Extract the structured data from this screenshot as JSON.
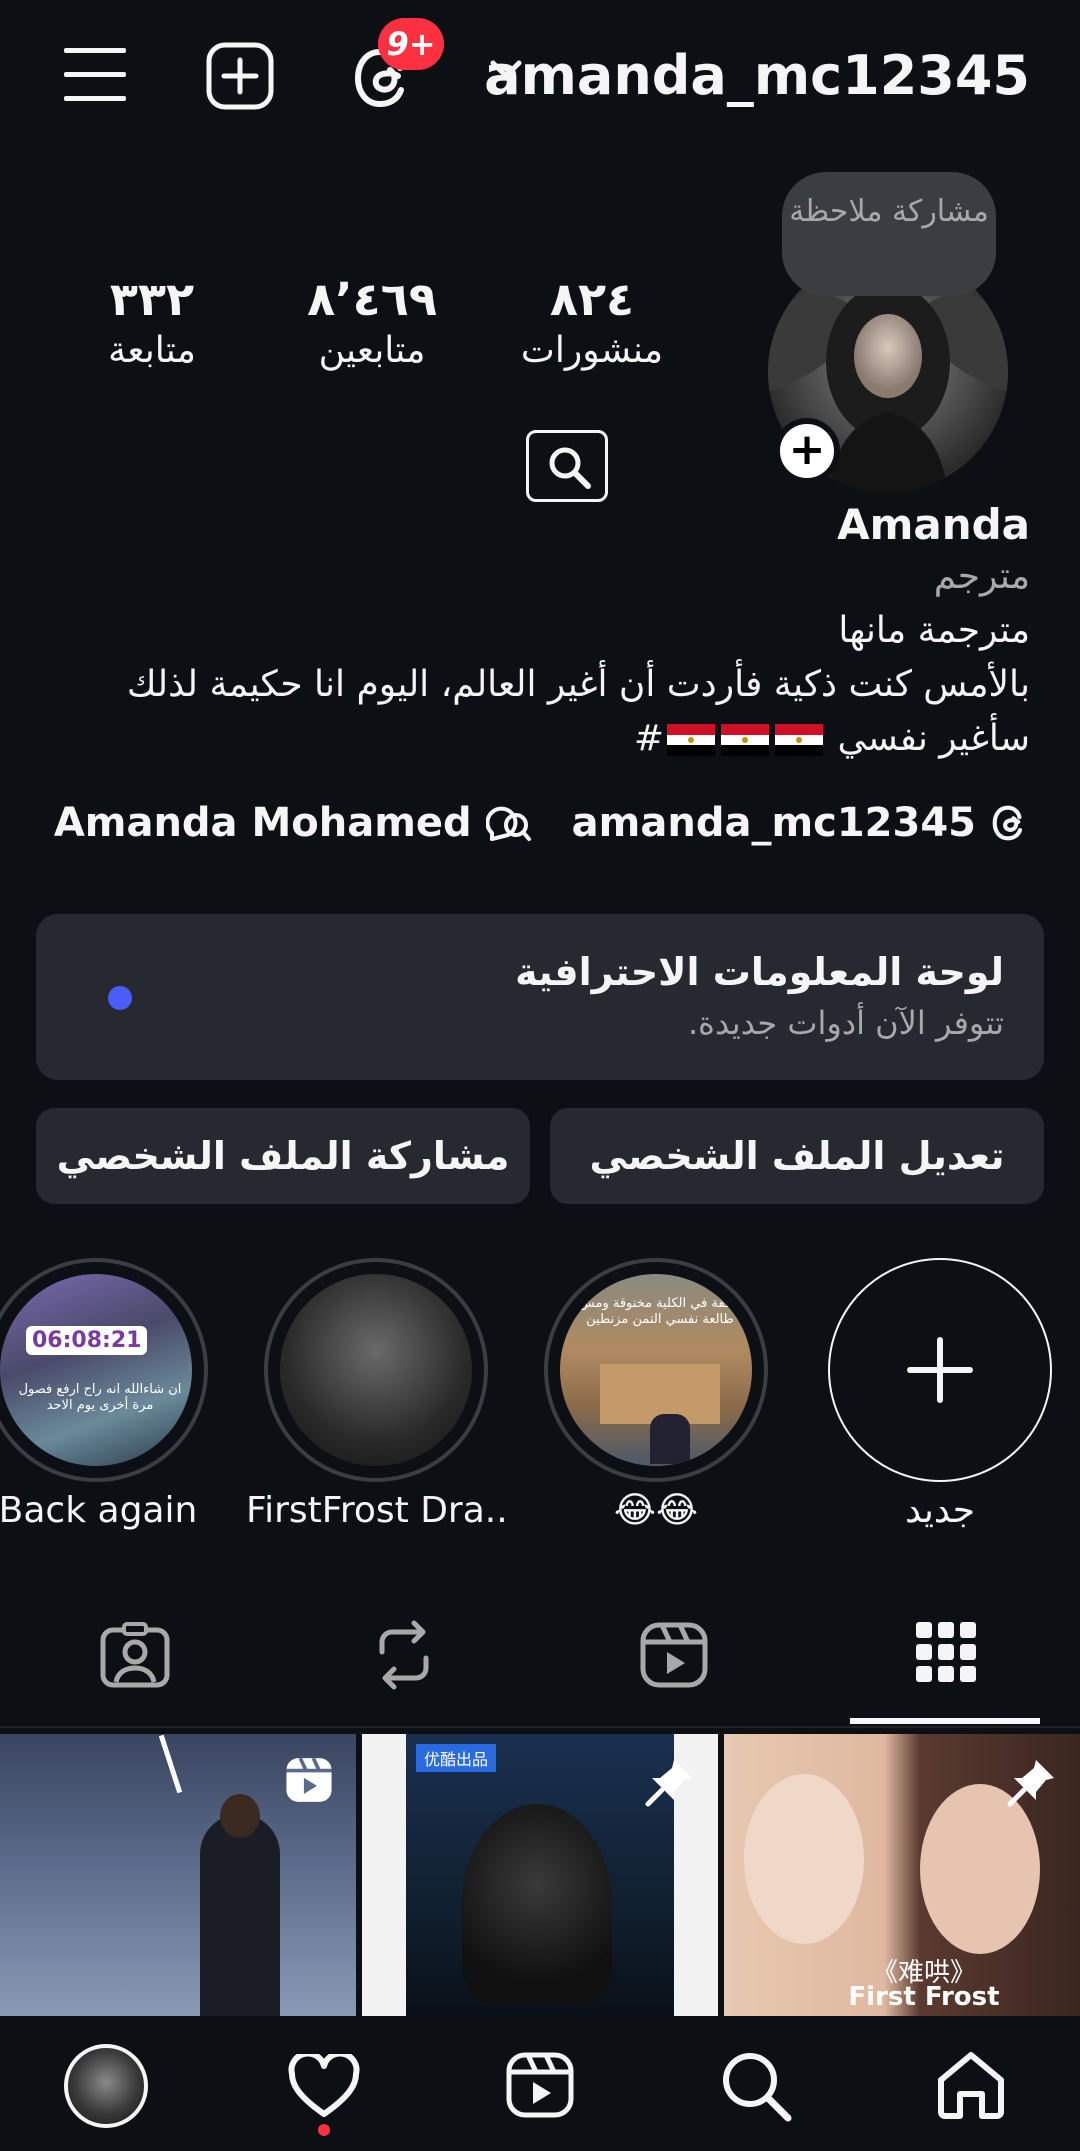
{
  "topbar": {
    "username": "amanda_mc12345",
    "threads_badge": "9+",
    "icons": [
      "menu-icon",
      "create-icon",
      "threads-icon",
      "chevron-down-icon"
    ]
  },
  "profile": {
    "note": "مشاركة ملاحظة",
    "add_story": "+",
    "stats": {
      "posts": {
        "value": "٨٢٤",
        "label": "منشورات"
      },
      "followers": {
        "value": "٨٬٤٦٩",
        "label": "متابعين"
      },
      "following": {
        "value": "٣٣٢",
        "label": "متابعة"
      }
    },
    "name": "Amanda",
    "category": "مترجم",
    "bio_line1": "مترجمة مانها",
    "bio_line2": "بالأمس كنت ذكية فأردت أن أغير العالم، اليوم انا حكيمة لذلك",
    "bio_line3_text": "سأغير نفسي",
    "bio_line3_hash": "#",
    "threads_link": "amanda_mc12345",
    "link_name": "Amanda Mohamed"
  },
  "pro_dashboard": {
    "title": "لوحة المعلومات الاحترافية",
    "subtitle": "تتوفر الآن أدوات جديدة."
  },
  "buttons": {
    "edit": "تعديل الملف الشخصي",
    "share": "مشاركة الملف الشخصي"
  },
  "highlights": [
    {
      "label": "جديد"
    },
    {
      "label": "😂😂"
    },
    {
      "label": "FirstFrost Dra..."
    },
    {
      "label": "Back again"
    }
  ],
  "highlight_overlays": {
    "timer": "06:08:21",
    "back_again_caption": "ان شاءالله انه راح ارفع فصول مرة أخرى يوم الاحد",
    "emoji_caption": "واقفة في الكلية مخنوقة ومش طالعة نفسي التمن مزنطين"
  },
  "posts": [
    {
      "type": "reel",
      "caption": ""
    },
    {
      "type": "pinned",
      "caption": "优酷出品"
    },
    {
      "type": "pinned",
      "caption": "《难哄》",
      "caption2": "First Frost"
    }
  ],
  "colors": {
    "bg": "#0c1014",
    "card": "#262a30",
    "badge": "#ff3040",
    "accent_dot": "#4a5df9",
    "notif_dot": "#ff3040"
  }
}
